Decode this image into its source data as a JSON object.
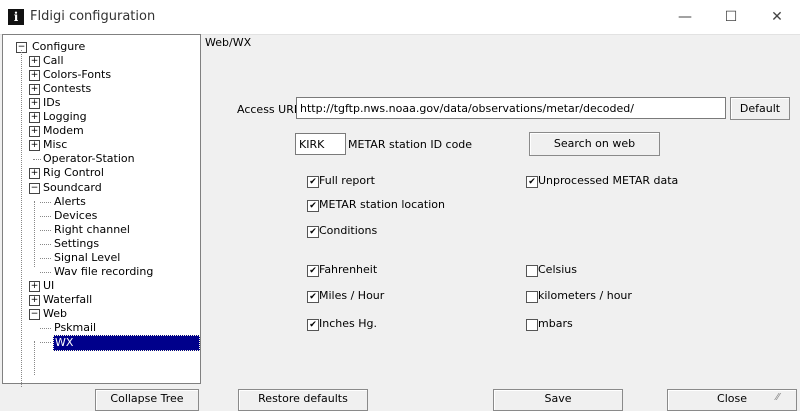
{
  "window": {
    "title": "Fldigi configuration",
    "icon_glyph": "i",
    "controls": {
      "minimize": "—",
      "maximize": "☐",
      "close": "✕"
    }
  },
  "tree": {
    "items": [
      {
        "label": "Configure",
        "exp": "−"
      },
      {
        "label": "Call",
        "exp": "+"
      },
      {
        "label": "Colors-Fonts",
        "exp": "+"
      },
      {
        "label": "Contests",
        "exp": "+"
      },
      {
        "label": "IDs",
        "exp": "+"
      },
      {
        "label": "Logging",
        "exp": "+"
      },
      {
        "label": "Modem",
        "exp": "+"
      },
      {
        "label": "Misc",
        "exp": "+"
      },
      {
        "label": "Operator-Station",
        "exp": ""
      },
      {
        "label": "Rig Control",
        "exp": "+"
      },
      {
        "label": "Soundcard",
        "exp": "−"
      },
      {
        "label": "Alerts",
        "exp": ""
      },
      {
        "label": "Devices",
        "exp": ""
      },
      {
        "label": "Right channel",
        "exp": ""
      },
      {
        "label": "Settings",
        "exp": ""
      },
      {
        "label": "Signal Level",
        "exp": ""
      },
      {
        "label": "Wav file recording",
        "exp": ""
      },
      {
        "label": "UI",
        "exp": "+"
      },
      {
        "label": "Waterfall",
        "exp": "+"
      },
      {
        "label": "Web",
        "exp": "−"
      },
      {
        "label": "Pskmail",
        "exp": ""
      },
      {
        "label": "WX",
        "exp": ""
      }
    ]
  },
  "panel": {
    "heading": "Web/WX",
    "access_url_label": "Access URL",
    "access_url_value": "http://tgftp.nws.noaa.gov/data/observations/metar/decoded/",
    "default_button": "Default",
    "station_value": "KIRK",
    "station_label": "METAR station ID code",
    "search_button": "Search on  web",
    "checkboxes": {
      "full_report": {
        "label": "Full report",
        "checked": true
      },
      "unprocessed": {
        "label": "Unprocessed METAR data",
        "checked": true
      },
      "station_location": {
        "label": "METAR station location",
        "checked": true
      },
      "conditions": {
        "label": "Conditions",
        "checked": true
      },
      "fahrenheit": {
        "label": "Fahrenheit",
        "checked": true
      },
      "celsius": {
        "label": "Celsius",
        "checked": false
      },
      "miles_hour": {
        "label": "Miles / Hour",
        "checked": true
      },
      "km_hour": {
        "label": "kilometers / hour",
        "checked": false
      },
      "inches_hg": {
        "label": "Inches Hg.",
        "checked": true
      },
      "mbars": {
        "label": "mbars",
        "checked": false
      }
    }
  },
  "footer": {
    "collapse_tree": "Collapse Tree",
    "restore_defaults": "Restore defaults",
    "save": "Save",
    "close": "Close"
  },
  "check_glyph": "✔"
}
